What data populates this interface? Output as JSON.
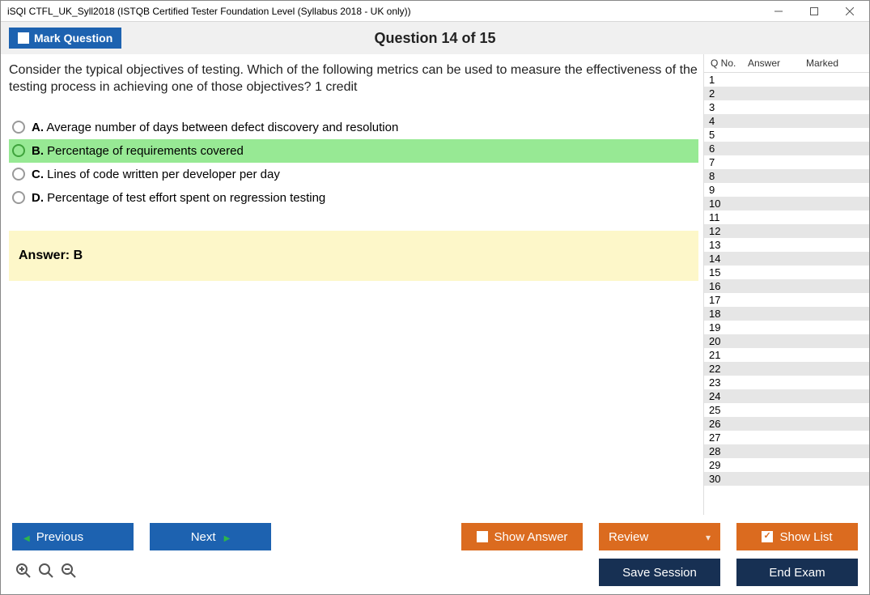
{
  "window": {
    "title": "iSQI CTFL_UK_Syll2018 (ISTQB Certified Tester Foundation Level (Syllabus 2018 - UK only))"
  },
  "header": {
    "mark_question_label": "Mark Question",
    "question_counter": "Question 14 of 15"
  },
  "question": {
    "text": "Consider the typical objectives of testing. Which of the following metrics can be used to measure the effectiveness of the testing process in achieving one of those objectives? 1 credit",
    "options": [
      {
        "letter": "A.",
        "text": "Average number of days between defect discovery and resolution",
        "correct": false
      },
      {
        "letter": "B.",
        "text": "Percentage of requirements covered",
        "correct": true
      },
      {
        "letter": "C.",
        "text": "Lines of code written per developer per day",
        "correct": false
      },
      {
        "letter": "D.",
        "text": "Percentage of test effort spent on regression testing",
        "correct": false
      }
    ],
    "answer_label": "Answer: B"
  },
  "sidebar": {
    "headers": {
      "qno": "Q No.",
      "answer": "Answer",
      "marked": "Marked"
    },
    "rows": [
      {
        "n": "1"
      },
      {
        "n": "2"
      },
      {
        "n": "3"
      },
      {
        "n": "4"
      },
      {
        "n": "5"
      },
      {
        "n": "6"
      },
      {
        "n": "7"
      },
      {
        "n": "8"
      },
      {
        "n": "9"
      },
      {
        "n": "10"
      },
      {
        "n": "11"
      },
      {
        "n": "12"
      },
      {
        "n": "13"
      },
      {
        "n": "14"
      },
      {
        "n": "15"
      },
      {
        "n": "16"
      },
      {
        "n": "17"
      },
      {
        "n": "18"
      },
      {
        "n": "19"
      },
      {
        "n": "20"
      },
      {
        "n": "21"
      },
      {
        "n": "22"
      },
      {
        "n": "23"
      },
      {
        "n": "24"
      },
      {
        "n": "25"
      },
      {
        "n": "26"
      },
      {
        "n": "27"
      },
      {
        "n": "28"
      },
      {
        "n": "29"
      },
      {
        "n": "30"
      }
    ]
  },
  "footer": {
    "previous": "Previous",
    "next": "Next",
    "show_answer": "Show Answer",
    "review": "Review",
    "show_list": "Show List",
    "save_session": "Save Session",
    "end_exam": "End Exam"
  }
}
